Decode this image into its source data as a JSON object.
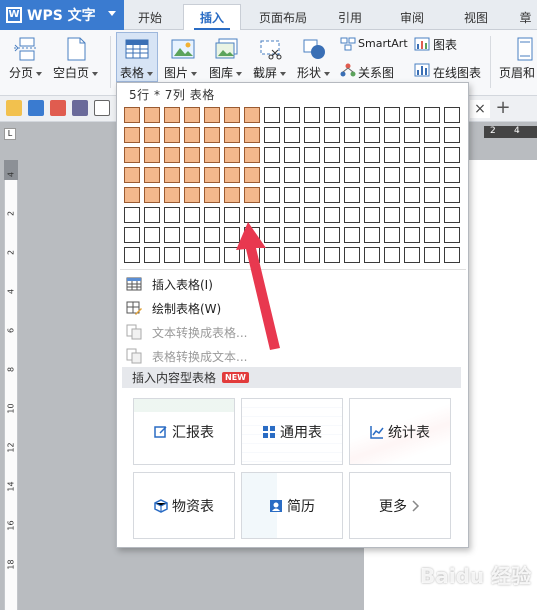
{
  "app": {
    "title": "WPS 文字",
    "logo_letter": "W"
  },
  "tabs": [
    {
      "label": "开始",
      "active": false
    },
    {
      "label": "插入",
      "active": true
    },
    {
      "label": "页面布局",
      "active": false
    },
    {
      "label": "引用",
      "active": false
    },
    {
      "label": "审阅",
      "active": false
    },
    {
      "label": "视图",
      "active": false
    },
    {
      "label": "章",
      "active": false
    }
  ],
  "ribbon": {
    "page_break": "分页",
    "blank_page": "空白页",
    "table": "表格",
    "picture": "图片",
    "gallery": "图库",
    "screenshot": "截屏",
    "shape": "形状",
    "smartart": "SmartArt",
    "chart": "图表",
    "relation_map": "关系图",
    "online_chart": "在线图表",
    "header_footer": "页眉和"
  },
  "ruler": {
    "h_ticks": [
      "2",
      "4"
    ],
    "v_ticks": [
      "4",
      "2",
      "2",
      "4",
      "6",
      "8",
      "10",
      "12",
      "14",
      "16",
      "18"
    ]
  },
  "table_picker": {
    "caption": "5行 * 7列 表格",
    "rows": 8,
    "cols": 17,
    "selected_rows": 5,
    "selected_cols": 7
  },
  "menu": {
    "insert_table": "插入表格(I)",
    "draw_table": "绘制表格(W)",
    "text_to_table": "文本转换成表格...",
    "table_to_text": "表格转换成文本..."
  },
  "content_tables": {
    "header": "插入内容型表格",
    "badge": "NEW",
    "cards": [
      {
        "label": "汇报表"
      },
      {
        "label": "通用表"
      },
      {
        "label": "统计表"
      },
      {
        "label": "物资表"
      },
      {
        "label": "简历"
      },
      {
        "label": "更多"
      }
    ]
  },
  "document_tab": {
    "close": "×",
    "add": "+"
  },
  "colors": {
    "accent": "#2a6cc4",
    "selected_cell": "#f3b88c",
    "arrow": "#e8384f",
    "badge": "#e23b3b"
  },
  "watermark": "Baidu 经验"
}
